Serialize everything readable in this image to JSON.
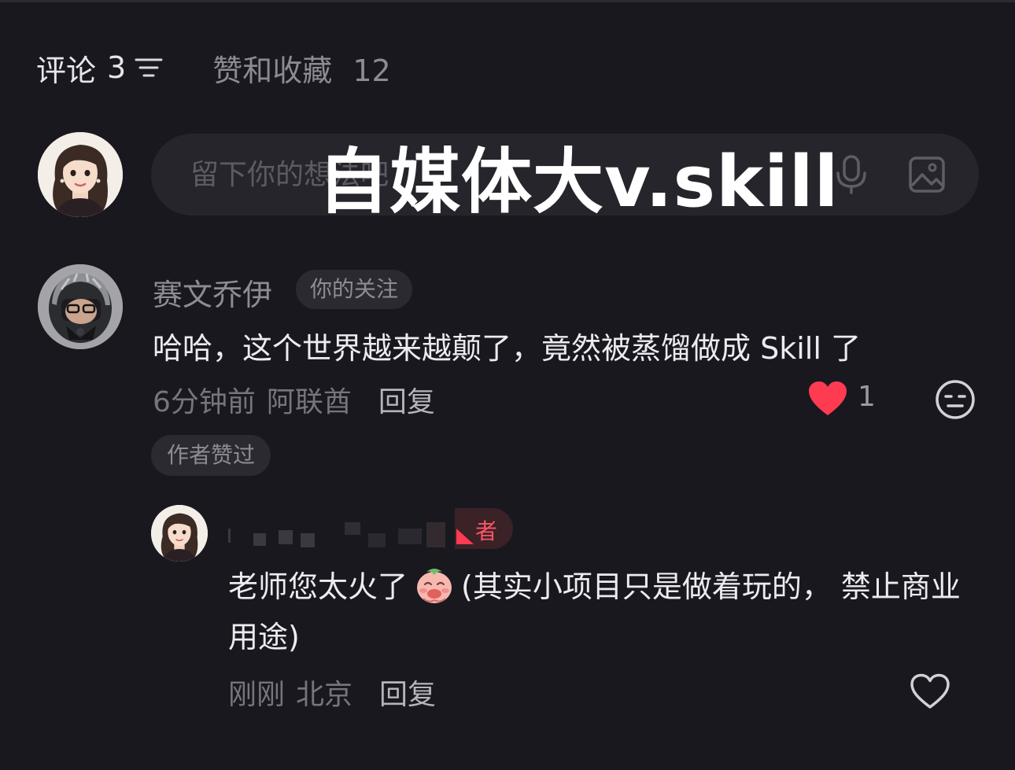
{
  "tabs": {
    "comments_label": "评论",
    "comments_count": "3",
    "likes_label": "赞和收藏",
    "likes_count": "12"
  },
  "compose": {
    "placeholder": "留下你的想法吧"
  },
  "watermark": "自媒体大v.skill",
  "comment": {
    "author": "赛文乔伊",
    "badge": "你的关注",
    "text": "哈哈，这个世界越来越颠了，竟然被蒸馏做成 Skill 了",
    "time": "6分钟前",
    "location": "阿联酋",
    "reply_label": "回复",
    "like_count": "1",
    "author_liked": "作者赞过",
    "heart_color": "#ff3b52"
  },
  "reply": {
    "badge": "者",
    "text_before_emoji": "老师您太火了",
    "emoji_icon": "smiling-face-emoji",
    "text_after_emoji": "(其实小项目只是做着玩的， 禁止商业用途)",
    "time": "刚刚",
    "location": "北京",
    "reply_label": "回复"
  },
  "colors": {
    "background": "#19181f",
    "accent_red": "#ff3b52"
  }
}
